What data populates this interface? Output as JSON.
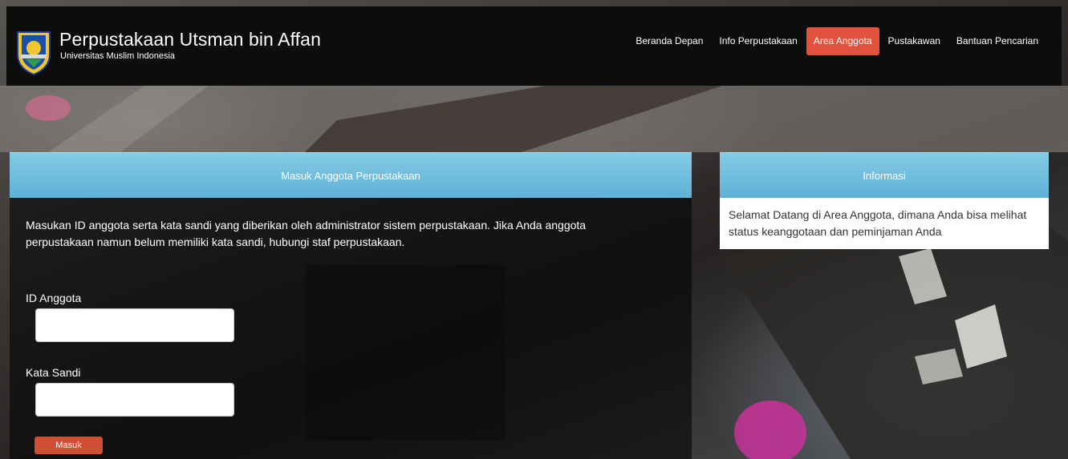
{
  "header": {
    "site_title": "Perpustakaan Utsman bin Affan",
    "site_subtitle": "Universitas Muslim Indonesia",
    "logo_icon": "university-crest-icon"
  },
  "nav": {
    "items": [
      {
        "label": "Beranda Depan",
        "active": false
      },
      {
        "label": "Info Perpustakaan",
        "active": false
      },
      {
        "label": "Area Anggota",
        "active": true
      },
      {
        "label": "Pustakawan",
        "active": false
      },
      {
        "label": "Bantuan Pencarian",
        "active": false
      }
    ],
    "active_color": "#e2533e"
  },
  "login": {
    "title": "Masuk Anggota Perpustakaan",
    "description": "Masukan ID anggota serta kata sandi yang diberikan oleh administrator sistem perpustakaan. Jika Anda anggota perpustakaan namun belum memiliki kata sandi, hubungi staf perpustakaan.",
    "id_label": "ID Anggota",
    "id_value": "",
    "password_label": "Kata Sandi",
    "password_value": "",
    "submit_label": "Masuk",
    "submit_color": "#cf4f34"
  },
  "info": {
    "title": "Informasi",
    "text": "Selamat Datang di Area Anggota, dimana Anda bisa melihat status keanggotaan dan peminjaman Anda"
  },
  "theme": {
    "panel_header_color": "#6ebfe0"
  }
}
